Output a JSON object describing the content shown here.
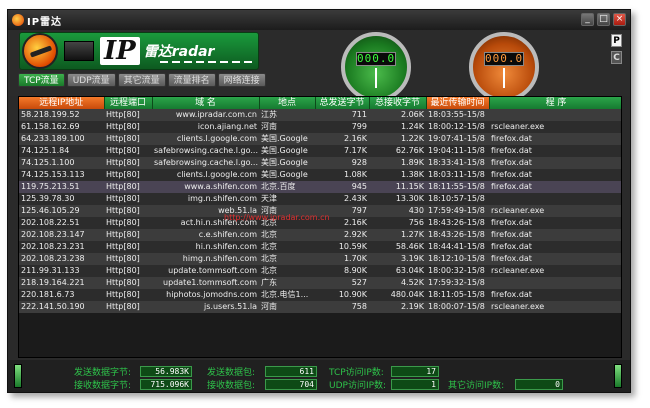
{
  "window": {
    "title": "IP雷达"
  },
  "logo": {
    "ip": "IP",
    "text": "雷达radar"
  },
  "gauges": {
    "left_value": "000.0",
    "right_value": "000.0"
  },
  "side_buttons": [
    "P",
    "C"
  ],
  "tabs": [
    "TCP流量",
    "UDP流量",
    "其它流量",
    "流量排名",
    "网络连接"
  ],
  "columns": [
    "远程IP地址",
    "远程端口",
    "域 名",
    "地点",
    "总发送字节",
    "总接收字节",
    "最近传输时间",
    "程 序"
  ],
  "rows": [
    [
      "58.218.199.52",
      "Http[80]",
      "www.ipradar.com.cn",
      "江苏",
      "711",
      "2.06K",
      "18:03:55-15/8",
      ""
    ],
    [
      "61.158.162.69",
      "Http[80]",
      "icon.ajiang.net",
      "河南",
      "799",
      "1.24K",
      "18:00:12-15/8",
      "rscleaner.exe"
    ],
    [
      "64.233.189.100",
      "Http[80]",
      "clients.l.google.com",
      "美国.Google",
      "2.16K",
      "1.22K",
      "19:07:41-15/8",
      "firefox.dat"
    ],
    [
      "74.125.1.84",
      "Http[80]",
      "safebrowsing.cache.l.go...",
      "美国.Google",
      "7.17K",
      "62.76K",
      "19:04:11-15/8",
      "firefox.dat"
    ],
    [
      "74.125.1.100",
      "Http[80]",
      "safebrowsing.cache.l.go...",
      "美国.Google",
      "928",
      "1.89K",
      "18:33:41-15/8",
      "firefox.dat"
    ],
    [
      "74.125.153.113",
      "Http[80]",
      "clients.l.google.com",
      "美国.Google",
      "1.08K",
      "1.38K",
      "18:03:11-15/8",
      "firefox.dat"
    ],
    [
      "119.75.213.51",
      "Http[80]",
      "www.a.shifen.com",
      "北京.百度",
      "945",
      "11.15K",
      "18:11:55-15/8",
      "firefox.dat"
    ],
    [
      "125.39.78.30",
      "Http[80]",
      "img.n.shifen.com",
      "天津",
      "2.43K",
      "13.30K",
      "18:10:57-15/8",
      ""
    ],
    [
      "125.46.105.29",
      "Http[80]",
      "web.51.la",
      "河南",
      "797",
      "430",
      "17:59:49-15/8",
      "rscleaner.exe"
    ],
    [
      "202.108.22.51",
      "Http[80]",
      "act.hi.n.shifen.com",
      "北京",
      "2.16K",
      "756",
      "18:43:26-15/8",
      "firefox.dat"
    ],
    [
      "202.108.23.147",
      "Http[80]",
      "c.e.shifen.com",
      "北京",
      "2.92K",
      "1.27K",
      "18:43:26-15/8",
      "firefox.dat"
    ],
    [
      "202.108.23.231",
      "Http[80]",
      "hi.n.shifen.com",
      "北京",
      "10.59K",
      "58.46K",
      "18:44:41-15/8",
      "firefox.dat"
    ],
    [
      "202.108.23.238",
      "Http[80]",
      "himg.n.shifen.com",
      "北京",
      "1.70K",
      "3.19K",
      "18:12:10-15/8",
      "firefox.dat"
    ],
    [
      "211.99.31.133",
      "Http[80]",
      "update.tommsoft.com",
      "北京",
      "8.90K",
      "63.04K",
      "18:00:32-15/8",
      "rscleaner.exe"
    ],
    [
      "218.19.164.221",
      "Http[80]",
      "update1.tommsoft.com",
      "广东",
      "527",
      "4.52K",
      "17:59:32-15/8",
      ""
    ],
    [
      "220.181.6.73",
      "Http[80]",
      "hiphotos.jomodns.com",
      "北京.电信1...",
      "10.90K",
      "480.04K",
      "18:11:05-15/8",
      "firefox.dat"
    ],
    [
      "222.141.50.190",
      "Http[80]",
      "js.users.51.la",
      "河南",
      "758",
      "2.19K",
      "18:00:07-15/8",
      "rscleaner.exe"
    ]
  ],
  "overlay": "http://www.ipradar.com.cn",
  "status": {
    "send_bytes_label": "发送数据字节:",
    "send_bytes": "56.983K",
    "recv_bytes_label": "接收数据字节:",
    "recv_bytes": "715.096K",
    "send_packets_label": "发送数据包:",
    "send_packets": "611",
    "recv_packets_label": "接收数据包:",
    "recv_packets": "704",
    "tcp_ip_label": "TCP访问IP数:",
    "tcp_ip": "17",
    "udp_ip_label": "UDP访问IP数:",
    "udp_ip": "1",
    "other_ip_label": "其它访问IP数:",
    "other_ip": "0"
  }
}
